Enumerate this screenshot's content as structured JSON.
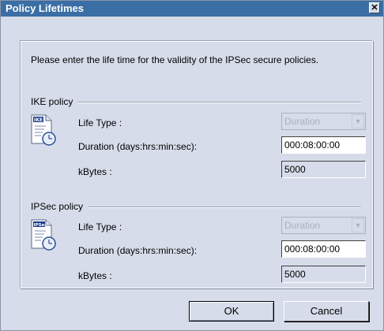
{
  "dialog": {
    "title": "Policy Lifetimes"
  },
  "intro_text": "Please enter the life time for the validity of the IPSec secure policies.",
  "ike": {
    "legend": "IKE policy",
    "icon_caption": "IKE",
    "life_type_label": "Life Type :",
    "life_type_value": "Duration",
    "duration_label": "Duration (days:hrs:min:sec):",
    "duration_value": "000:08:00:00",
    "kbytes_label": "kBytes :",
    "kbytes_value": "5000"
  },
  "ipsec": {
    "legend": "IPSec policy",
    "icon_caption": "IPSec",
    "life_type_label": "Life Type :",
    "life_type_value": "Duration",
    "duration_label": "Duration (days:hrs:min:sec):",
    "duration_value": "000:08:00:00",
    "kbytes_label": "kBytes :",
    "kbytes_value": "5000"
  },
  "buttons": {
    "ok": "OK",
    "cancel": "Cancel"
  },
  "colors": {
    "titlebar": "#3a6ea5",
    "dialog_bg": "#d6dce9"
  },
  "icons": {
    "close": "close-icon",
    "policy": "document-clock-icon"
  }
}
